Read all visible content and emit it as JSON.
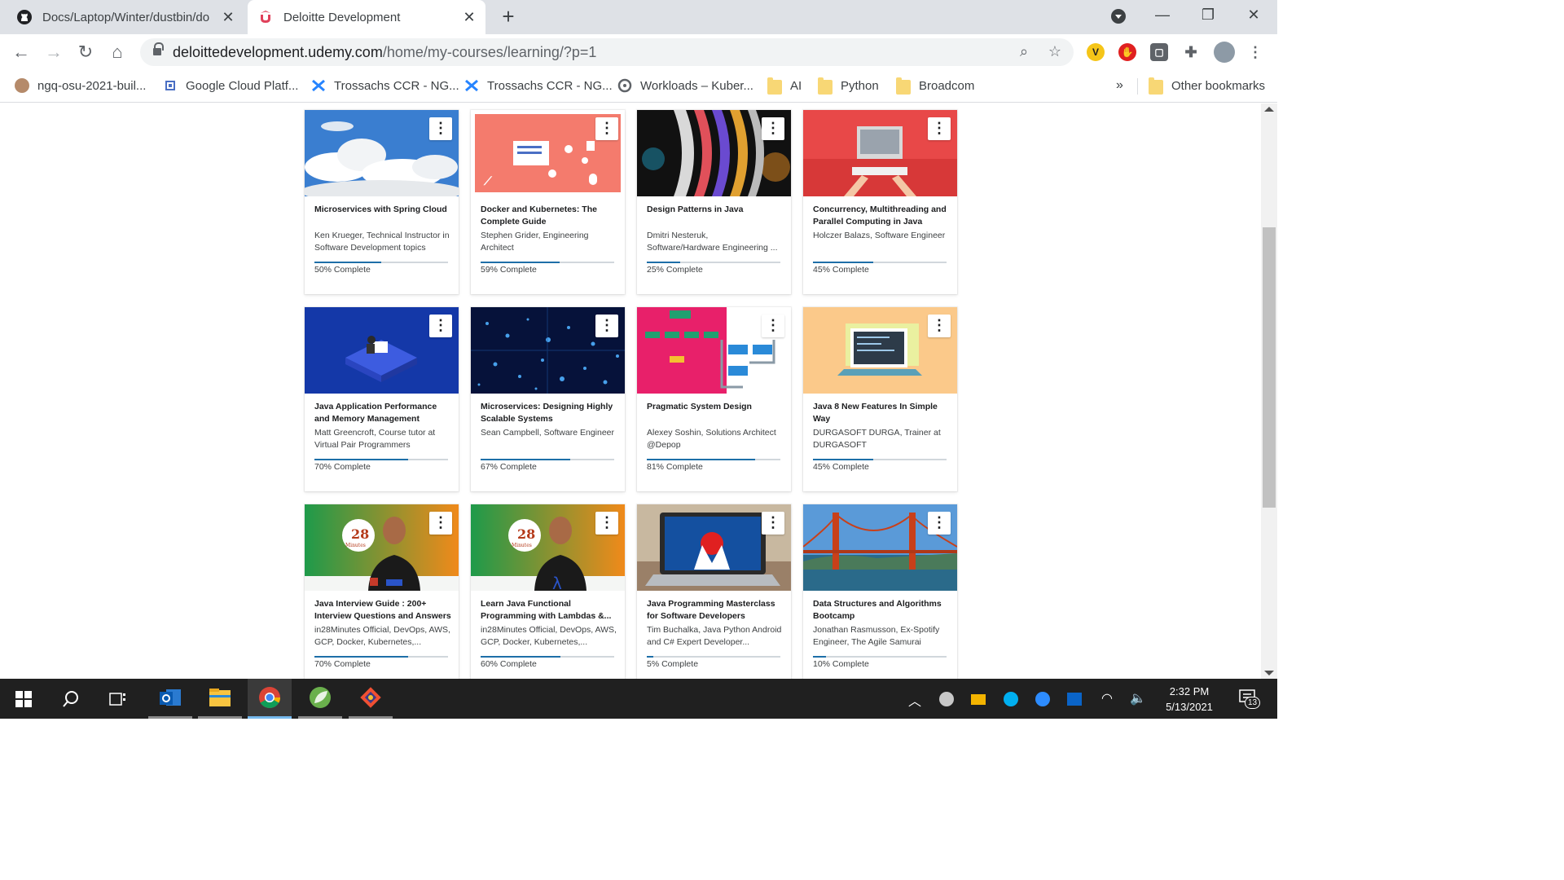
{
  "tabs": [
    {
      "title": "Docs/Laptop/Winter/dustbin/do",
      "icon": "github-icon",
      "close": "✕"
    },
    {
      "title": "Deloitte Development",
      "icon": "udemy-icon",
      "close": "✕"
    }
  ],
  "toolbar": {
    "url_host": "deloittedevelopment.udemy.com",
    "url_path": "/home/my-courses/learning/?p=1",
    "ext_v": "V"
  },
  "bookmarks": [
    {
      "label": "ngq-osu-2021-buil...",
      "icon": "avatar-icon"
    },
    {
      "label": "Google Cloud Platf...",
      "icon": "gcp-icon"
    },
    {
      "label": "Trossachs CCR - NG...",
      "icon": "jira-icon"
    },
    {
      "label": "Trossachs CCR - NG...",
      "icon": "jira-icon"
    },
    {
      "label": "Workloads – Kuber...",
      "icon": "kubernetes-icon"
    },
    {
      "label": "AI",
      "icon": "folder-icon"
    },
    {
      "label": "Python",
      "icon": "folder-icon"
    },
    {
      "label": "Broadcom",
      "icon": "folder-icon"
    }
  ],
  "bookmarks_more": "»",
  "other_bookmarks": "Other bookmarks",
  "courses": [
    {
      "title": "Microservices with Spring Cloud",
      "author": "Ken Krueger, Technical Instructor in Software Development topics",
      "progress": 50,
      "progress_label": "50% Complete"
    },
    {
      "title": "Docker and Kubernetes: The Complete Guide",
      "author": "Stephen Grider, Engineering Architect",
      "progress": 59,
      "progress_label": "59% Complete"
    },
    {
      "title": "Design Patterns in Java",
      "author": "Dmitri Nesteruk, Software/Hardware Engineering ...",
      "progress": 25,
      "progress_label": "25% Complete"
    },
    {
      "title": "Concurrency, Multithreading and Parallel Computing in Java",
      "author": "Holczer Balazs, Software Engineer",
      "progress": 45,
      "progress_label": "45% Complete"
    },
    {
      "title": "Java Application Performance and Memory Management",
      "author": "Matt Greencroft, Course tutor at Virtual Pair Programmers",
      "progress": 70,
      "progress_label": "70% Complete"
    },
    {
      "title": "Microservices: Designing Highly Scalable Systems",
      "author": "Sean Campbell, Software Engineer",
      "progress": 67,
      "progress_label": "67% Complete"
    },
    {
      "title": "Pragmatic System Design",
      "author": "Alexey Soshin, Solutions Architect @Depop",
      "progress": 81,
      "progress_label": "81% Complete"
    },
    {
      "title": "Java 8 New Features In Simple Way",
      "author": "DURGASOFT DURGA, Trainer at DURGASOFT",
      "progress": 45,
      "progress_label": "45% Complete"
    },
    {
      "title": "Java Interview Guide : 200+ Interview Questions and Answers",
      "author": "in28Minutes Official, DevOps, AWS, GCP, Docker, Kubernetes,...",
      "progress": 70,
      "progress_label": "70% Complete"
    },
    {
      "title": "Learn Java Functional Programming with Lambdas &...",
      "author": "in28Minutes Official, DevOps, AWS, GCP, Docker, Kubernetes,...",
      "progress": 60,
      "progress_label": "60% Complete"
    },
    {
      "title": "Java Programming Masterclass for Software Developers",
      "author": "Tim Buchalka, Java Python Android and C# Expert Developer...",
      "progress": 5,
      "progress_label": "5% Complete"
    },
    {
      "title": "Data Structures and Algorithms Bootcamp",
      "author": "Jonathan Rasmusson, Ex-Spotify Engineer, The Agile Samurai",
      "progress": 10,
      "progress_label": "10% Complete"
    }
  ],
  "thumb_text": {
    "in28": "28",
    "in28_small": "In",
    "minutes": "Minutes",
    "lambda": "λ"
  },
  "kebab_glyph": "⋮",
  "taskbar": {
    "time": "2:32 PM",
    "date": "5/13/2021",
    "notifications": "13"
  },
  "colors": {
    "progress": "#1e6fa8",
    "accent": "#a435f0"
  }
}
